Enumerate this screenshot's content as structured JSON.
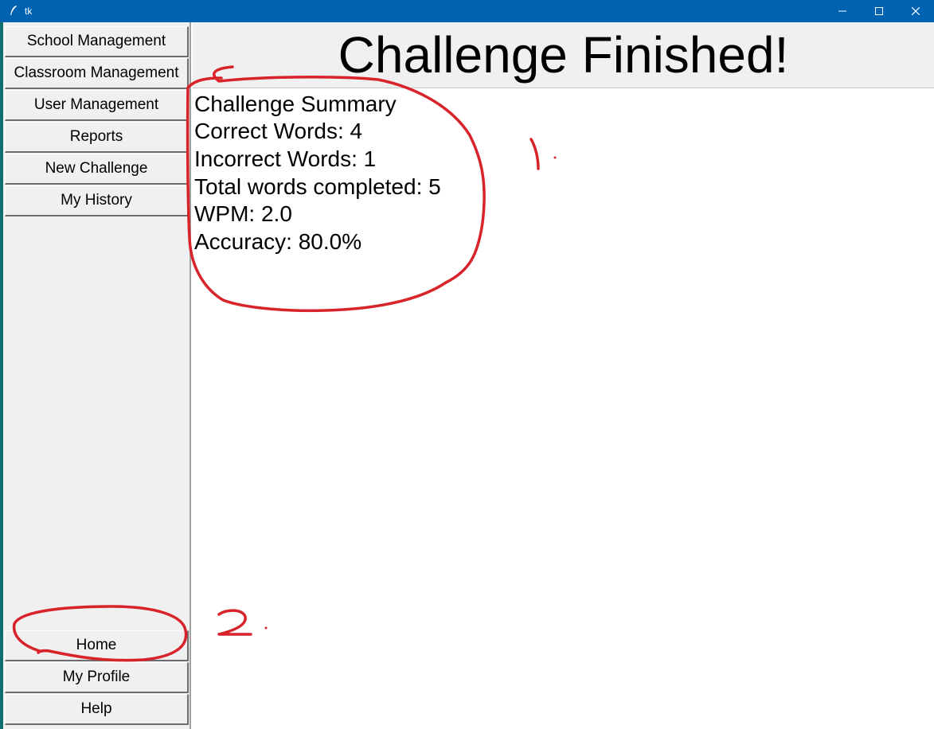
{
  "window": {
    "title": "tk"
  },
  "sidebar": {
    "top_items": [
      {
        "label": "School Management"
      },
      {
        "label": "Classroom Management"
      },
      {
        "label": "User Management"
      },
      {
        "label": "Reports"
      },
      {
        "label": "New Challenge"
      },
      {
        "label": "My History"
      }
    ],
    "bottom_items": [
      {
        "label": "Home"
      },
      {
        "label": "My Profile"
      },
      {
        "label": "Help"
      }
    ]
  },
  "header": {
    "title": "Challenge Finished!"
  },
  "summary": {
    "heading": "Challenge Summary",
    "correct_words": "Correct Words: 4",
    "incorrect_words": "Incorrect Words: 1",
    "total_words": "Total words completed: 5",
    "wpm": "WPM: 2.0",
    "accuracy": "Accuracy: 80.0%"
  },
  "annotations": {
    "marker_1": "1.",
    "marker_2": "2.",
    "ink_color": "#d8232a"
  },
  "colors": {
    "titlebar": "#0063b1",
    "panel": "#f0f0f0"
  }
}
